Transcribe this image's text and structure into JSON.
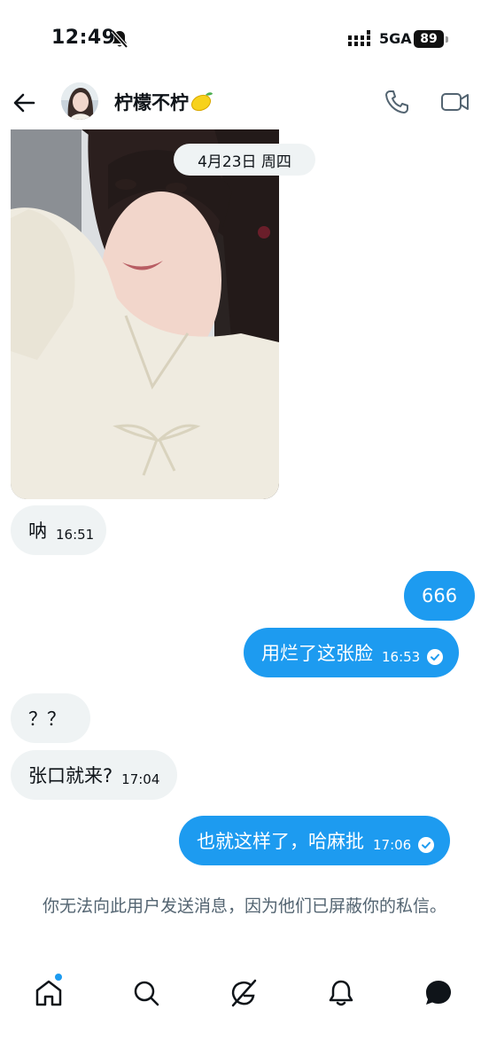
{
  "status_bar": {
    "time": "12:49",
    "network": "5GA",
    "battery": "89"
  },
  "header": {
    "contact_name": "柠檬不柠"
  },
  "chat": {
    "date_separator": "4月23日 周四",
    "messages": [
      {
        "direction": "incoming",
        "text": "呐",
        "time": "16:51"
      },
      {
        "direction": "outgoing",
        "text": "666",
        "time": ""
      },
      {
        "direction": "outgoing",
        "text": "用烂了这张脸",
        "time": "16:53",
        "read": true
      },
      {
        "direction": "incoming",
        "text": "？？",
        "time": ""
      },
      {
        "direction": "incoming",
        "text": "张口就来?",
        "time": "17:04"
      },
      {
        "direction": "outgoing",
        "text": "也就这样了，哈麻批",
        "time": "17:06",
        "read": true
      }
    ],
    "blocked_notice": "你无法向此用户发送消息，因为他们已屏蔽你的私信。"
  },
  "bottom_nav": {
    "items": [
      {
        "icon": "home-icon",
        "has_notification_dot": true
      },
      {
        "icon": "search-icon"
      },
      {
        "icon": "grok-icon"
      },
      {
        "icon": "bell-icon"
      },
      {
        "icon": "messages-icon",
        "active": true
      }
    ]
  },
  "colors": {
    "accent": "#1d9bf0",
    "incoming_bubble": "#eff3f4",
    "muted_text": "#536471"
  }
}
